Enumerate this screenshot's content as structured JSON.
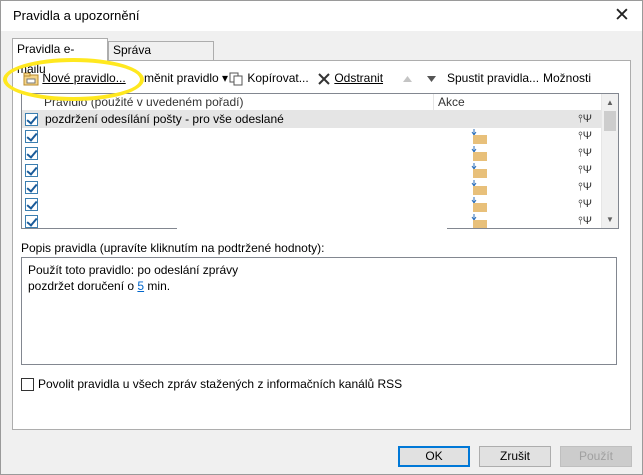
{
  "window": {
    "title": "Pravidla a upozornění",
    "close_glyph": "✕"
  },
  "tabs": [
    {
      "label": "Pravidla e-mailu",
      "active": true
    },
    {
      "label": "Správa upozornění",
      "active": false
    }
  ],
  "toolbar": {
    "new_rule": "Nové pravidlo...",
    "change_rule": "měnit pravidlo",
    "dropdown_glyph": "▾",
    "copy": "Kopírovat...",
    "delete": "Odstranit",
    "run_rules": "Spustit pravidla...",
    "options": "Možnosti",
    "icons": [
      "new-rule-icon",
      "copy-icon",
      "delete-icon",
      "move-up-icon",
      "move-down-icon"
    ]
  },
  "rules_list": {
    "col_rule": "Pravidlo (použité v uvedeném pořadí)",
    "col_action": "Akce",
    "rows": [
      {
        "name": "pozdržení odesílání pošty - pro vše odeslané",
        "checked": true,
        "selected": true
      },
      {
        "name": "",
        "checked": true,
        "selected": false
      },
      {
        "name": "",
        "checked": true,
        "selected": false
      },
      {
        "name": "",
        "checked": true,
        "selected": false
      },
      {
        "name": "",
        "checked": true,
        "selected": false
      },
      {
        "name": "",
        "checked": true,
        "selected": false
      },
      {
        "name": "",
        "checked": true,
        "selected": false
      }
    ]
  },
  "description": {
    "label": "Popis pravidla (upravíte kliknutím na podtržené hodnoty):",
    "line1": "Použít toto pravidlo: po odeslání zprávy",
    "line2_pre": "pozdržet doručení o ",
    "line2_link": "5",
    "line2_post": " min."
  },
  "rss": {
    "label": "Povolit pravidla u všech zpráv stažených z informačních kanálů RSS",
    "checked": false
  },
  "buttons": {
    "ok": "OK",
    "cancel": "Zrušit",
    "apply": "Použít"
  },
  "colors": {
    "highlight": "#ffe81f",
    "link": "#0066cc",
    "selected_row": "#e5e5e5",
    "default_button_border": "#0078d7"
  }
}
